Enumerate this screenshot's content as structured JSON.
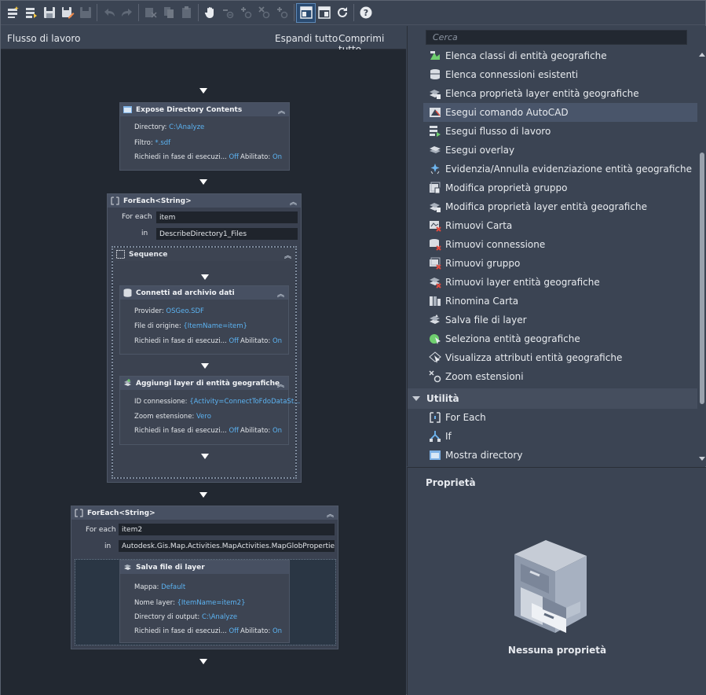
{
  "toolbar": {
    "icons": [
      "new-workflow-icon",
      "open-workflow-icon",
      "save-icon",
      "save-as-icon",
      "save-all-icon",
      "undo-icon",
      "redo-icon",
      "cut-icon",
      "copy-icon",
      "paste-icon",
      "pan-hand-icon",
      "zoom-out-icon",
      "zoom-in-icon",
      "zoom-reset-icon",
      "zoom-fit-icon",
      "layout-vertical-icon",
      "layout-horizontal-icon",
      "refresh-icon",
      "help-icon"
    ]
  },
  "workflow": {
    "title": "Flusso di lavoro",
    "expand_all": "Espandi tutto",
    "collapse_all": "Comprimi tutto"
  },
  "expose": {
    "title": "Expose Directory Contents",
    "dir_label": "Directory:",
    "dir_value": "C:\\Analyze",
    "filter_label": "Filtro:",
    "filter_value": "*.sdf",
    "ask_label": "Richiedi in fase di esecuzi...",
    "ask_value": "Off",
    "enabled_label": "Abilitato:",
    "enabled_value": "On"
  },
  "foreach1": {
    "title": "ForEach<String>",
    "for_each_label": "For each",
    "for_each_value": "item",
    "in_label": "in",
    "in_value": "DescribeDirectory1_Files"
  },
  "sequence": {
    "title": "Sequence"
  },
  "connect": {
    "title": "Connetti ad archivio dati",
    "provider_label": "Provider:",
    "provider_value": "OSGeo.SDF",
    "source_label": "File di origine:",
    "source_value": "{ItemName=item}",
    "ask_label": "Richiedi in fase di esecuzi...",
    "ask_value": "Off",
    "enabled_label": "Abilitato:",
    "enabled_value": "On"
  },
  "addlayer": {
    "title": "Aggiungi layer di entità geografiche",
    "conn_label": "ID connessione:",
    "conn_value": "{Activity=ConnectToFdoDataSt...",
    "zoom_label": "Zoom estensione:",
    "zoom_value": "Vero",
    "ask_label": "Richiedi in fase di esecuzi...",
    "ask_value": "Off",
    "enabled_label": "Abilitato:",
    "enabled_value": "On"
  },
  "foreach2": {
    "title": "ForEach<String>",
    "for_each_label": "For each",
    "for_each_value": "item2",
    "in_label": "in",
    "in_value": "Autodesk.Gis.Map.Activities.MapActivities.MapGlobProperties.Layers"
  },
  "savelayer": {
    "title": "Salva file di layer",
    "map_label": "Mappa:",
    "map_value": "Default",
    "layer_label": "Nome layer:",
    "layer_value": "{ItemName=item2}",
    "outdir_label": "Directory di output:",
    "outdir_value": "C:\\Analyze",
    "ask_label": "Richiedi in fase di esecuzi...",
    "ask_value": "Off",
    "enabled_label": "Abilitato:",
    "enabled_value": "On"
  },
  "search": {
    "placeholder": "Cerca"
  },
  "activities": [
    {
      "label": "Elenca classi di entità geografiche",
      "icon": "list-classes-icon"
    },
    {
      "label": "Elenca connessioni esistenti",
      "icon": "list-connections-icon"
    },
    {
      "label": "Elenca proprietà layer entità geografiche",
      "icon": "list-layer-properties-icon"
    },
    {
      "label": "Esegui comando AutoCAD",
      "icon": "autocad-command-icon"
    },
    {
      "label": "Esegui flusso di lavoro",
      "icon": "run-workflow-icon"
    },
    {
      "label": "Esegui overlay",
      "icon": "overlay-icon"
    },
    {
      "label": "Evidenzia/Annulla evidenziazione entità geografiche",
      "icon": "highlight-icon"
    },
    {
      "label": "Modifica proprietà gruppo",
      "icon": "group-properties-icon"
    },
    {
      "label": "Modifica proprietà layer entità geografiche",
      "icon": "layer-properties-icon"
    },
    {
      "label": "Rimuovi Carta",
      "icon": "remove-map-icon"
    },
    {
      "label": "Rimuovi connessione",
      "icon": "remove-connection-icon"
    },
    {
      "label": "Rimuovi gruppo",
      "icon": "remove-group-icon"
    },
    {
      "label": "Rimuovi layer entità geografiche",
      "icon": "remove-layer-icon"
    },
    {
      "label": "Rinomina Carta",
      "icon": "rename-map-icon"
    },
    {
      "label": "Salva file di layer",
      "icon": "save-layer-icon"
    },
    {
      "label": "Seleziona entità geografiche",
      "icon": "select-features-icon"
    },
    {
      "label": "Visualizza attributi entità geografiche",
      "icon": "show-attributes-icon"
    },
    {
      "label": "Zoom estensioni",
      "icon": "zoom-extents-icon"
    }
  ],
  "utility": {
    "label": "Utilità",
    "items": [
      {
        "label": "For Each",
        "icon": "foreach-icon"
      },
      {
        "label": "If",
        "icon": "if-icon"
      },
      {
        "label": "Mostra directory",
        "icon": "show-directory-icon"
      }
    ]
  },
  "properties": {
    "title": "Proprietà",
    "empty": "Nessuna proprietà"
  }
}
